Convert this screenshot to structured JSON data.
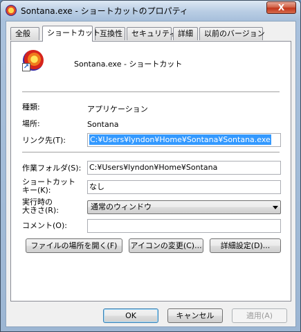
{
  "window": {
    "title": "Sontana.exe - ショートカットのプロパティ",
    "close_label": "X"
  },
  "tabs": [
    {
      "label": "全般"
    },
    {
      "label": "ショートカット"
    },
    {
      "label": "互換性"
    },
    {
      "label": "セキュリティ"
    },
    {
      "label": "詳細"
    },
    {
      "label": "以前のバージョン"
    }
  ],
  "header": {
    "name": "Sontana.exe - ショートカット"
  },
  "info": {
    "type_label": "種類:",
    "type_value": "アプリケーション",
    "location_label": "場所:",
    "location_value": "Sontana"
  },
  "form": {
    "target_label": "リンク先(T):",
    "target_value": "C:¥Users¥lyndon¥Home¥Sontana¥Sontana.exe",
    "workdir_label": "作業フォルダ(S):",
    "workdir_value": "C:¥Users¥lyndon¥Home¥Sontana",
    "shortcut_label_1": "ショートカット",
    "shortcut_label_2": "キー(K):",
    "shortcut_value": "なし",
    "run_label_1": "実行時の",
    "run_label_2": "大きさ(R):",
    "run_value": "通常のウィンドウ",
    "comment_label": "コメント(O):",
    "comment_value": ""
  },
  "actions": {
    "open_location": "ファイルの場所を開く(F)",
    "change_icon": "アイコンの変更(C)...",
    "advanced": "詳細設定(D)..."
  },
  "footer": {
    "ok": "OK",
    "cancel": "キャンセル",
    "apply": "適用(A)"
  }
}
